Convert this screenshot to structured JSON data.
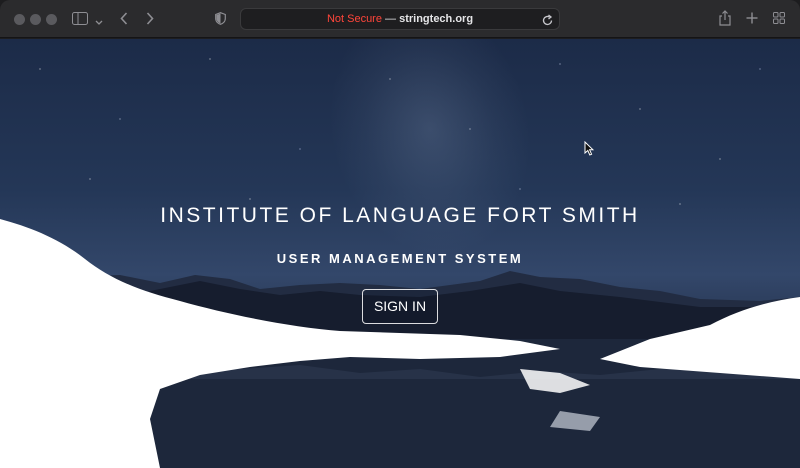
{
  "browser": {
    "address_security": "Not Secure",
    "address_separator": " — ",
    "address_host": "stringtech.org",
    "icons": [
      "close-dot",
      "minimize-dot",
      "zoom-dot",
      "sidebar-icon",
      "chevron-down-icon",
      "back-icon",
      "forward-icon",
      "shield-icon",
      "reload-icon",
      "share-icon",
      "new-tab-icon",
      "tab-overview-icon"
    ]
  },
  "hero": {
    "title": "INSTITUTE OF LANGUAGE FORT SMITH",
    "subtitle": "USER MANAGEMENT SYSTEM",
    "sign_in_label": "SIGN IN"
  },
  "colors": {
    "not_secure": "#ff453a",
    "sky_top": "#1c2b48",
    "mountain": "#1a2236",
    "snow": "#ffffff"
  }
}
